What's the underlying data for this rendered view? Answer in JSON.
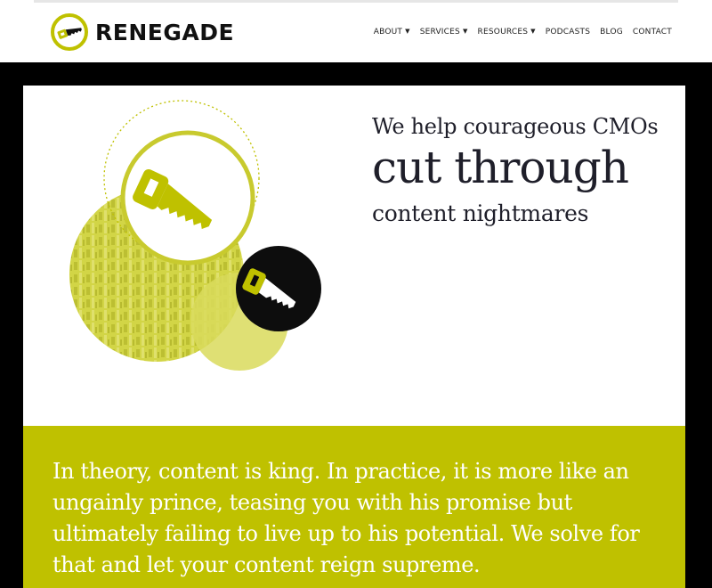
{
  "brand": {
    "name": "RENEGADE",
    "accent": "#bfc100",
    "dark": "#111111",
    "logo_icon": "saw-icon"
  },
  "nav": {
    "items": [
      {
        "label": "ABOUT",
        "dropdown": true
      },
      {
        "label": "SERVICES",
        "dropdown": true
      },
      {
        "label": "RESOURCES",
        "dropdown": true
      },
      {
        "label": "PODCASTS",
        "dropdown": false
      },
      {
        "label": "BLOG",
        "dropdown": false
      },
      {
        "label": "CONTACT",
        "dropdown": false
      }
    ]
  },
  "hero": {
    "line1": "We help courageous CMOs",
    "line2": "cut through",
    "line3": "content nightmares",
    "illustration_icons": [
      "saw-icon",
      "saw-icon"
    ]
  },
  "band": {
    "text": "In theory, content is king. In practice, it is more like an ungainly prince, teasing you with his promise but ultimately failing to live up to his potential. We solve for that and let your content reign supreme."
  }
}
